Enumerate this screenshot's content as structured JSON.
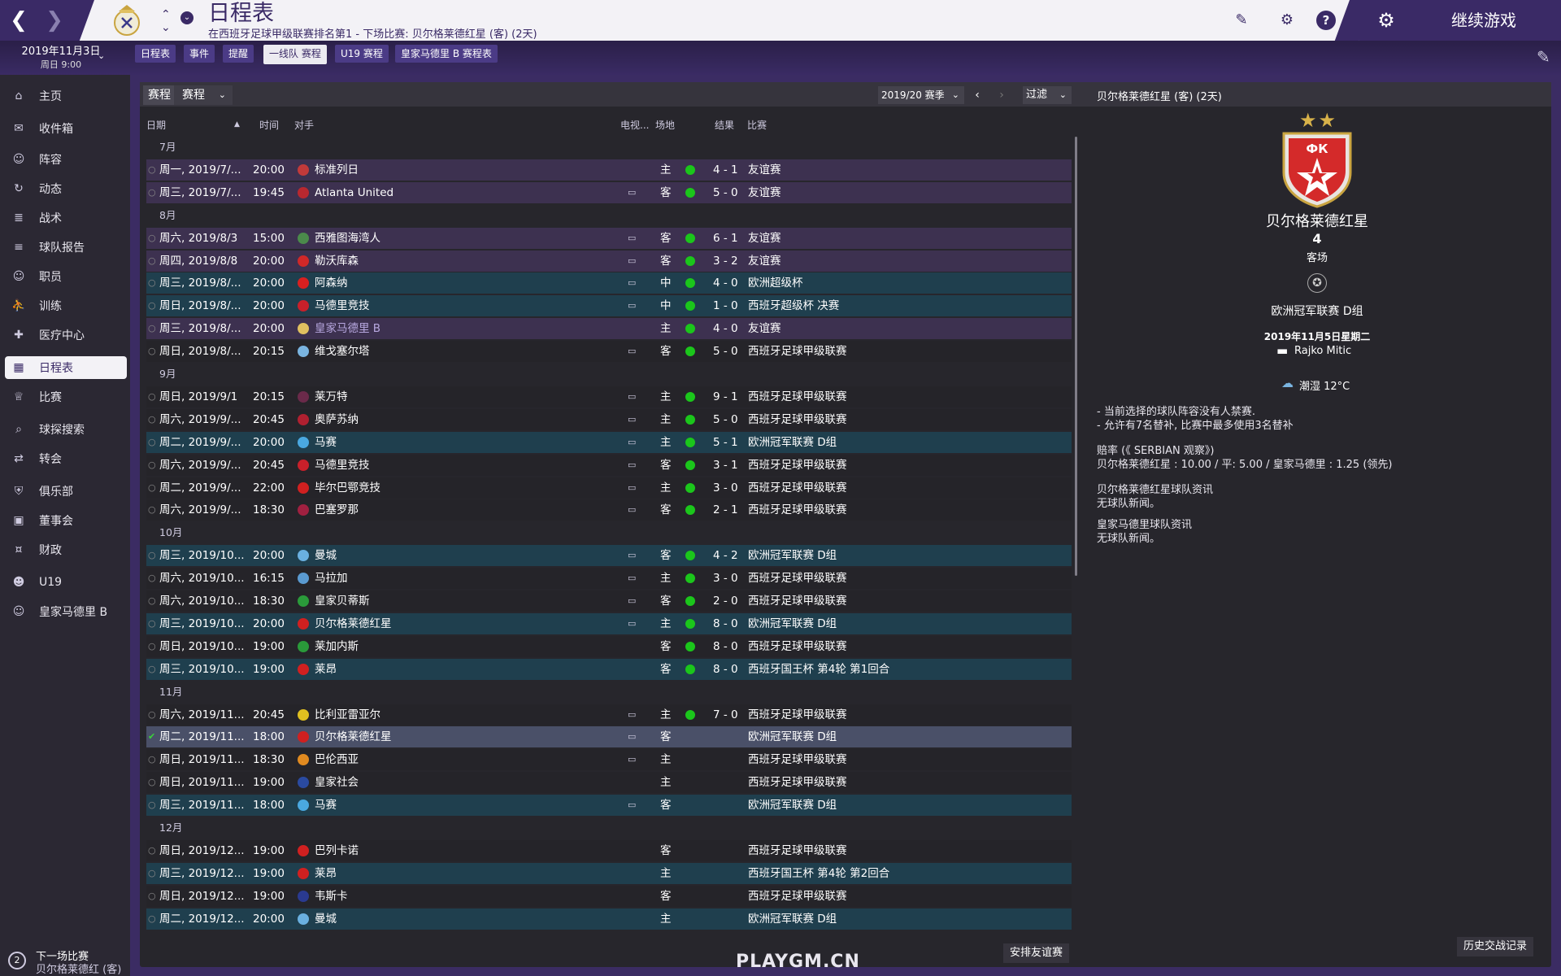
{
  "header": {
    "title": "日程表",
    "subtitle": "在西班牙足球甲级联赛排名第1 - 下场比赛: 贝尔格莱德红星 (客) (2天)",
    "continue_label": "继续游戏",
    "help_label": "?"
  },
  "date": {
    "day": "2019年11月3日",
    "time": "周日 9:00"
  },
  "subtabs": [
    "日程表",
    "事件",
    "提醒",
    "一线队 赛程",
    "U19 赛程",
    "皇家马德里 B 赛程表"
  ],
  "sidebar": {
    "items": [
      {
        "label": "主页",
        "icon": "home-icon"
      },
      {
        "label": "收件箱",
        "icon": "inbox-icon"
      },
      {
        "label": "阵容",
        "icon": "squad-icon"
      },
      {
        "label": "动态",
        "icon": "dynamics-icon"
      },
      {
        "label": "战术",
        "icon": "tactics-icon"
      },
      {
        "label": "球队报告",
        "icon": "report-icon"
      },
      {
        "label": "职员",
        "icon": "staff-icon"
      },
      {
        "label": "训练",
        "icon": "training-icon"
      },
      {
        "label": "医疗中心",
        "icon": "medical-icon"
      },
      {
        "label": "日程表",
        "icon": "calendar-icon"
      },
      {
        "label": "比赛",
        "icon": "trophy-icon"
      },
      {
        "label": "球探搜索",
        "icon": "search-icon"
      },
      {
        "label": "转会",
        "icon": "transfer-icon"
      },
      {
        "label": "俱乐部",
        "icon": "shield-icon"
      },
      {
        "label": "董事会",
        "icon": "board-icon"
      },
      {
        "label": "财政",
        "icon": "finance-icon"
      },
      {
        "label": "U19",
        "icon": "youth-icon"
      },
      {
        "label": "皇家马德里 B",
        "icon": "reserve-icon"
      }
    ],
    "next_match_label": "下一场比赛",
    "next_match_value": "贝尔格莱德红 (客)",
    "next_match_days": "2"
  },
  "toolbar": {
    "tab_label": "赛程",
    "view_select": "赛程",
    "season_select": "2019/20 赛季",
    "filter_select": "过滤",
    "right_header": "贝尔格莱德红星 (客) (2天)"
  },
  "columns": [
    "日期",
    "时间",
    "对手",
    "电视...",
    "场地",
    "结果",
    "比赛"
  ],
  "matches": [
    {
      "type": "month",
      "label": "7月"
    },
    {
      "date": "周一, 2019/7/...",
      "time": "20:00",
      "opponent": "标准列日",
      "tv": false,
      "venue": "主",
      "played": true,
      "result": "4 - 1",
      "comp": "友谊赛",
      "bg": "purple",
      "badge": "#c23a3a"
    },
    {
      "date": "周三, 2019/7/...",
      "time": "19:45",
      "opponent": "Atlanta United",
      "tv": true,
      "venue": "客",
      "played": true,
      "result": "5 - 0",
      "comp": "友谊赛",
      "bg": "purple",
      "badge": "#b8282f"
    },
    {
      "type": "month",
      "label": "8月"
    },
    {
      "date": "周六, 2019/8/3",
      "time": "15:00",
      "opponent": "西雅图海湾人",
      "tv": true,
      "venue": "客",
      "played": true,
      "result": "6 - 1",
      "comp": "友谊赛",
      "bg": "purple",
      "badge": "#4b8a4b"
    },
    {
      "date": "周四, 2019/8/8",
      "time": "20:00",
      "opponent": "勒沃库森",
      "tv": true,
      "venue": "客",
      "played": true,
      "result": "3 - 2",
      "comp": "友谊赛",
      "bg": "purple",
      "badge": "#d02828"
    },
    {
      "date": "周三, 2019/8/...",
      "time": "20:00",
      "opponent": "阿森纳",
      "tv": true,
      "venue": "中",
      "played": true,
      "result": "4 - 0",
      "comp": "欧洲超级杯",
      "bg": "teal",
      "badge": "#d82020"
    },
    {
      "date": "周日, 2019/8/...",
      "time": "20:00",
      "opponent": "马德里竞技",
      "tv": true,
      "venue": "中",
      "played": true,
      "result": "1 - 0",
      "comp": "西班牙超级杯 决赛",
      "bg": "teal",
      "badge": "#c8202a"
    },
    {
      "date": "周三, 2019/8/...",
      "time": "20:00",
      "opponent": "皇家马德里 B",
      "tv": false,
      "venue": "主",
      "played": true,
      "result": "4 - 0",
      "comp": "友谊赛",
      "bg": "purple",
      "badge": "#e0c060",
      "dim": true
    },
    {
      "date": "周日, 2019/8/...",
      "time": "20:15",
      "opponent": "维戈塞尔塔",
      "tv": true,
      "venue": "客",
      "played": true,
      "result": "5 - 0",
      "comp": "西班牙足球甲级联赛",
      "bg": "dark",
      "badge": "#7ab4e0"
    },
    {
      "type": "month",
      "label": "9月"
    },
    {
      "date": "周日, 2019/9/1",
      "time": "20:15",
      "opponent": "莱万特",
      "tv": true,
      "venue": "主",
      "played": true,
      "result": "9 - 1",
      "comp": "西班牙足球甲级联赛",
      "bg": "dark",
      "badge": "#6a2a4a"
    },
    {
      "date": "周六, 2019/9/...",
      "time": "20:45",
      "opponent": "奥萨苏纳",
      "tv": true,
      "venue": "主",
      "played": true,
      "result": "5 - 0",
      "comp": "西班牙足球甲级联赛",
      "bg": "dark",
      "badge": "#b02030"
    },
    {
      "date": "周二, 2019/9/...",
      "time": "20:00",
      "opponent": "马赛",
      "tv": true,
      "venue": "主",
      "played": true,
      "result": "5 - 1",
      "comp": "欧洲冠军联赛 D组",
      "bg": "teal",
      "badge": "#4aa8e0"
    },
    {
      "date": "周六, 2019/9/...",
      "time": "20:45",
      "opponent": "马德里竞技",
      "tv": true,
      "venue": "客",
      "played": true,
      "result": "3 - 1",
      "comp": "西班牙足球甲级联赛",
      "bg": "dark",
      "badge": "#c8202a"
    },
    {
      "date": "周二, 2019/9/...",
      "time": "22:00",
      "opponent": "毕尔巴鄂竞技",
      "tv": true,
      "venue": "主",
      "played": true,
      "result": "3 - 0",
      "comp": "西班牙足球甲级联赛",
      "bg": "dark",
      "badge": "#d02020"
    },
    {
      "date": "周六, 2019/9/...",
      "time": "18:30",
      "opponent": "巴塞罗那",
      "tv": true,
      "venue": "客",
      "played": true,
      "result": "2 - 1",
      "comp": "西班牙足球甲级联赛",
      "bg": "dark",
      "badge": "#a02040"
    },
    {
      "type": "month",
      "label": "10月"
    },
    {
      "date": "周三, 2019/10...",
      "time": "20:00",
      "opponent": "曼城",
      "tv": true,
      "venue": "客",
      "played": true,
      "result": "4 - 2",
      "comp": "欧洲冠军联赛 D组",
      "bg": "teal",
      "badge": "#6ab0e0"
    },
    {
      "date": "周六, 2019/10...",
      "time": "16:15",
      "opponent": "马拉加",
      "tv": true,
      "venue": "主",
      "played": true,
      "result": "3 - 0",
      "comp": "西班牙足球甲级联赛",
      "bg": "dark",
      "badge": "#5a9ad0"
    },
    {
      "date": "周六, 2019/10...",
      "time": "18:30",
      "opponent": "皇家贝蒂斯",
      "tv": true,
      "venue": "客",
      "played": true,
      "result": "2 - 0",
      "comp": "西班牙足球甲级联赛",
      "bg": "dark",
      "badge": "#2a9a3a"
    },
    {
      "date": "周三, 2019/10...",
      "time": "20:00",
      "opponent": "贝尔格莱德红星",
      "tv": true,
      "venue": "主",
      "played": true,
      "result": "8 - 0",
      "comp": "欧洲冠军联赛 D组",
      "bg": "teal",
      "badge": "#d02020"
    },
    {
      "date": "周日, 2019/10...",
      "time": "19:00",
      "opponent": "莱加内斯",
      "tv": false,
      "venue": "客",
      "played": true,
      "result": "8 - 0",
      "comp": "西班牙足球甲级联赛",
      "bg": "dark",
      "badge": "#2a9a3a"
    },
    {
      "date": "周三, 2019/10...",
      "time": "19:00",
      "opponent": "莱昂",
      "tv": false,
      "venue": "客",
      "played": true,
      "result": "8 - 0",
      "comp": "西班牙国王杯 第4轮 第1回合",
      "bg": "teal",
      "badge": "#d02020"
    },
    {
      "type": "month",
      "label": "11月"
    },
    {
      "date": "周六, 2019/11...",
      "time": "20:45",
      "opponent": "比利亚雷亚尔",
      "tv": true,
      "venue": "主",
      "played": true,
      "result": "7 - 0",
      "comp": "西班牙足球甲级联赛",
      "bg": "dark",
      "badge": "#e0c020"
    },
    {
      "date": "周二, 2019/11...",
      "time": "18:00",
      "opponent": "贝尔格莱德红星",
      "tv": true,
      "venue": "客",
      "played": false,
      "result": "",
      "comp": "欧洲冠军联赛 D组",
      "bg": "sel",
      "badge": "#d02020",
      "selected": true
    },
    {
      "date": "周日, 2019/11...",
      "time": "18:30",
      "opponent": "巴伦西亚",
      "tv": true,
      "venue": "主",
      "played": false,
      "result": "",
      "comp": "西班牙足球甲级联赛",
      "bg": "dark",
      "badge": "#e08a20"
    },
    {
      "date": "周日, 2019/11...",
      "time": "19:00",
      "opponent": "皇家社会",
      "tv": false,
      "venue": "主",
      "played": false,
      "result": "",
      "comp": "西班牙足球甲级联赛",
      "bg": "dark",
      "badge": "#2a4aa0"
    },
    {
      "date": "周三, 2019/11...",
      "time": "18:00",
      "opponent": "马赛",
      "tv": true,
      "venue": "客",
      "played": false,
      "result": "",
      "comp": "欧洲冠军联赛 D组",
      "bg": "teal",
      "badge": "#4aa8e0"
    },
    {
      "type": "month",
      "label": "12月"
    },
    {
      "date": "周日, 2019/12...",
      "time": "19:00",
      "opponent": "巴列卡诺",
      "tv": false,
      "venue": "客",
      "played": false,
      "result": "",
      "comp": "西班牙足球甲级联赛",
      "bg": "dark",
      "badge": "#d02020"
    },
    {
      "date": "周三, 2019/12...",
      "time": "19:00",
      "opponent": "莱昂",
      "tv": false,
      "venue": "主",
      "played": false,
      "result": "",
      "comp": "西班牙国王杯 第4轮 第2回合",
      "bg": "teal",
      "badge": "#d02020"
    },
    {
      "date": "周日, 2019/12...",
      "time": "19:00",
      "opponent": "韦斯卡",
      "tv": false,
      "venue": "客",
      "played": false,
      "result": "",
      "comp": "西班牙足球甲级联赛",
      "bg": "dark",
      "badge": "#2a3a90"
    },
    {
      "date": "周二, 2019/12...",
      "time": "20:00",
      "opponent": "曼城",
      "tv": false,
      "venue": "主",
      "played": false,
      "result": "",
      "comp": "欧洲冠军联赛 D组",
      "bg": "teal",
      "badge": "#6ab0e0"
    }
  ],
  "detail": {
    "team": "贝尔格莱德红星",
    "crest_text": "ФК",
    "position": "4",
    "venue": "客场",
    "competition": "欧洲冠军联赛 D组",
    "date": "2019年11月5日星期二",
    "stadium": "Rajko Mitic",
    "weather": "潮湿 12°C",
    "notes": [
      "- 当前选择的球队阵容没有人禁赛.",
      "- 允许有7名替补, 比赛中最多使用3名替补"
    ],
    "odds_title": "赔率 (《 SERBIAN 观察》)",
    "odds_text": "贝尔格莱德红星 : 10.00 / 平: 5.00 / 皇家马德里 : 1.25 (领先)",
    "news1_title": "贝尔格莱德红星球队资讯",
    "news1_text": "无球队新闻。",
    "news2_title": "皇家马德里球队资讯",
    "news2_text": "无球队新闻。"
  },
  "buttons": {
    "arrange_friendly": "安排友谊赛",
    "history": "历史交战记录"
  },
  "watermark": "PLAYGM.CN"
}
